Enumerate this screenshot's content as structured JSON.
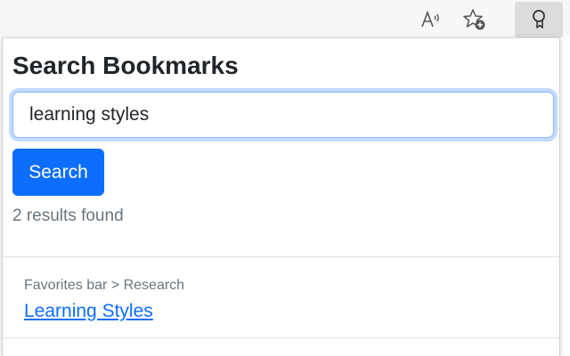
{
  "toolbar": {
    "icons": [
      "read-aloud-icon",
      "add-favorite-icon",
      "bookmark-search-extension-icon"
    ]
  },
  "popup": {
    "title": "Search Bookmarks",
    "search": {
      "value": "learning styles",
      "placeholder": ""
    },
    "search_button_label": "Search",
    "result_count": "2 results found",
    "results": [
      {
        "path": "Favorites bar > Research",
        "title": "Learning Styles"
      }
    ]
  },
  "colors": {
    "primary": "#0d6efd",
    "muted_text": "#6c757d",
    "focus_border": "#86b7fe"
  }
}
